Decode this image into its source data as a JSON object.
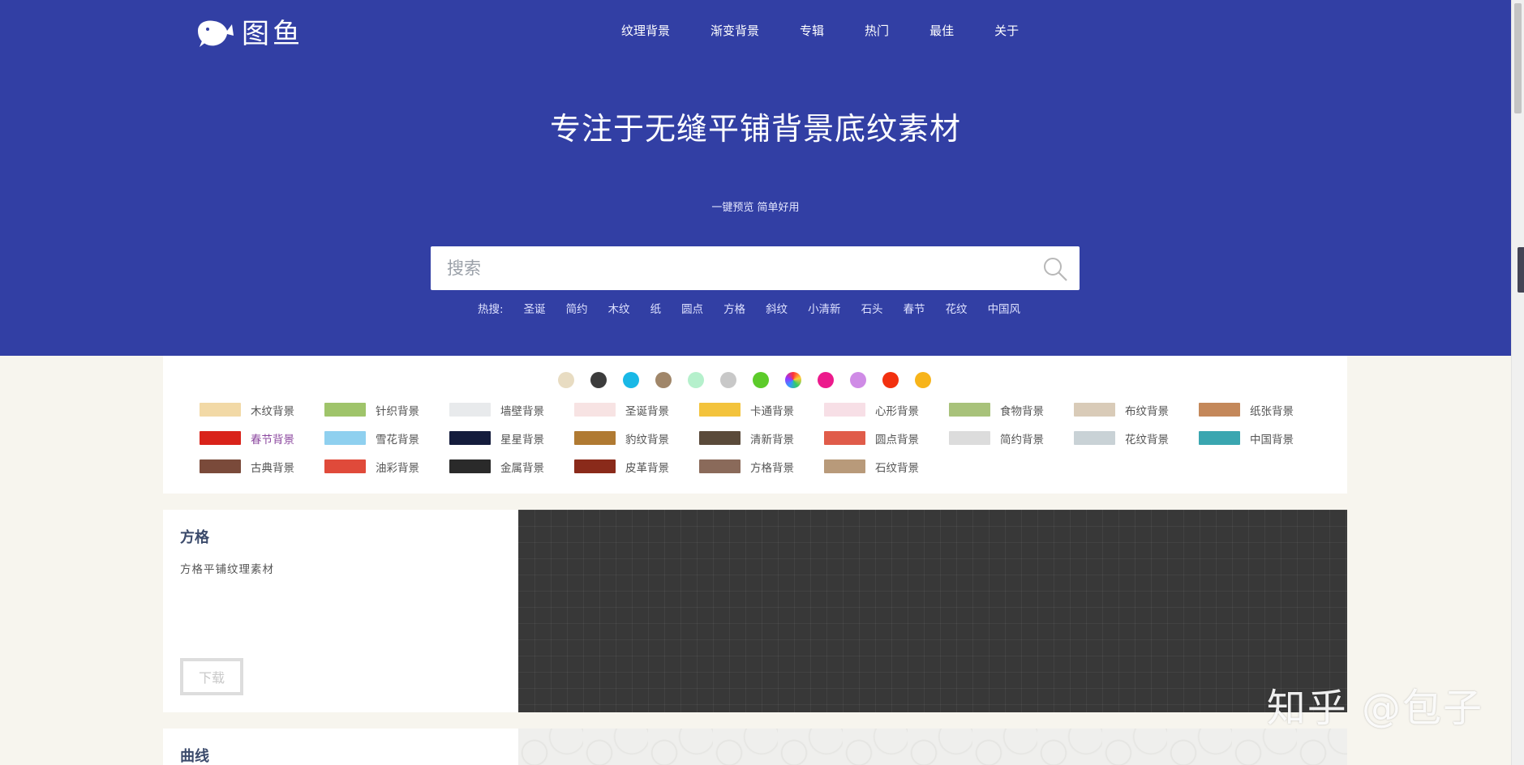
{
  "brand": {
    "name": "图鱼"
  },
  "nav": [
    "纹理背景",
    "渐变背景",
    "专辑",
    "热门",
    "最佳",
    "关于"
  ],
  "hero": {
    "title": "专注于无缝平铺背景底纹素材",
    "subtitle": "一键预览 简单好用",
    "search_placeholder": "搜索",
    "hot_label": "热搜:",
    "hot_terms": [
      "圣诞",
      "简约",
      "木纹",
      "纸",
      "圆点",
      "方格",
      "斜纹",
      "小清新",
      "石头",
      "春节",
      "花纹",
      "中国风"
    ]
  },
  "colors": [
    "#e8dcc2",
    "#3c3c3c",
    "#19b8e6",
    "#a08669",
    "#b5f0cc",
    "#c8c8c8",
    "#5ccb2a",
    "#multicolor",
    "#ec1a8c",
    "#cf8be6",
    "#f2300f",
    "#f7b41a"
  ],
  "categories": [
    {
      "label": "木纹背景",
      "thumb": "#f2d9a6"
    },
    {
      "label": "针织背景",
      "thumb": "#9fc46a"
    },
    {
      "label": "墙壁背景",
      "thumb": "#e8eaec"
    },
    {
      "label": "圣诞背景",
      "thumb": "#f7e3e3"
    },
    {
      "label": "卡通背景",
      "thumb": "#f3c33c"
    },
    {
      "label": "心形背景",
      "thumb": "#f7dfe6"
    },
    {
      "label": "食物背景",
      "thumb": "#a8c27a"
    },
    {
      "label": "布纹背景",
      "thumb": "#d9cbb8"
    },
    {
      "label": "纸张背景",
      "thumb": "#c4885a"
    },
    {
      "label": "春节背景",
      "thumb": "#d9231a",
      "purple": true
    },
    {
      "label": "雪花背景",
      "thumb": "#8fd0ef"
    },
    {
      "label": "星星背景",
      "thumb": "#141c3c"
    },
    {
      "label": "豹纹背景",
      "thumb": "#b07a32"
    },
    {
      "label": "清新背景",
      "thumb": "#5a4a3a"
    },
    {
      "label": "圆点背景",
      "thumb": "#e05c4a"
    },
    {
      "label": "简约背景",
      "thumb": "#dcdcdc"
    },
    {
      "label": "花纹背景",
      "thumb": "#c9d2d6"
    },
    {
      "label": "中国背景",
      "thumb": "#3aa6b0"
    },
    {
      "label": "古典背景",
      "thumb": "#7a4a3a"
    },
    {
      "label": "油彩背景",
      "thumb": "#e04a3a"
    },
    {
      "label": "金属背景",
      "thumb": "#2a2a2a"
    },
    {
      "label": "皮革背景",
      "thumb": "#8a2a1a"
    },
    {
      "label": "方格背景",
      "thumb": "#8a6a5a"
    },
    {
      "label": "石纹背景",
      "thumb": "#b89a7a"
    }
  ],
  "cards": [
    {
      "title": "方格",
      "desc": "方格平铺纹理素材",
      "button": "下载"
    },
    {
      "title": "曲线"
    }
  ],
  "watermark": "知乎 @包子"
}
